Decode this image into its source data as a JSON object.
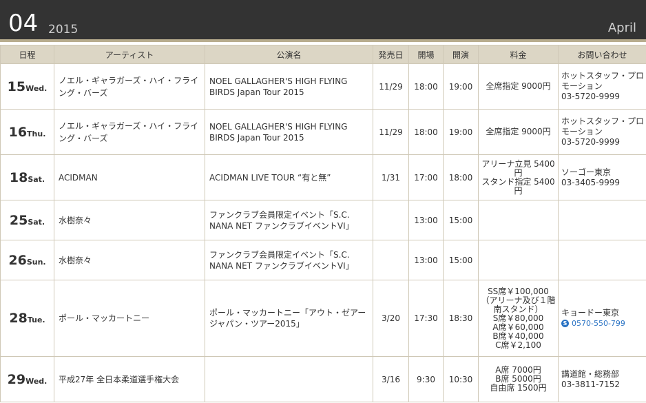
{
  "header": {
    "month": "04",
    "year": "2015",
    "month_name": "April"
  },
  "columns": [
    "日程",
    "アーティスト",
    "公演名",
    "発売日",
    "開場",
    "開演",
    "料金",
    "お問い合わせ"
  ],
  "rows": [
    {
      "day": "15",
      "weekday": "Wed.",
      "artist": "ノエル・ギャラガーズ・ハイ・フライング・バーズ",
      "title": "NOEL GALLAGHER'S HIGH FLYING BIRDS Japan Tour 2015",
      "sale": "11/29",
      "open": "18:00",
      "start": "19:00",
      "price": [
        "全席指定 9000円"
      ],
      "contact": [
        "ホットスタッフ・プロモーション",
        "03-5720-9999"
      ]
    },
    {
      "day": "16",
      "weekday": "Thu.",
      "artist": "ノエル・ギャラガーズ・ハイ・フライング・バーズ",
      "title": "NOEL GALLAGHER'S HIGH FLYING BIRDS Japan Tour 2015",
      "sale": "11/29",
      "open": "18:00",
      "start": "19:00",
      "price": [
        "全席指定 9000円"
      ],
      "contact": [
        "ホットスタッフ・プロモーション",
        "03-5720-9999"
      ]
    },
    {
      "day": "18",
      "weekday": "Sat.",
      "artist": "ACIDMAN",
      "title": "ACIDMAN LIVE TOUR “有と無”",
      "sale": "1/31",
      "open": "17:00",
      "start": "18:00",
      "price": [
        "アリーナ立見 5400円",
        "スタンド指定 5400円"
      ],
      "contact": [
        "ソーゴー東京",
        "03-3405-9999"
      ]
    },
    {
      "day": "25",
      "weekday": "Sat.",
      "artist": "水樹奈々",
      "title": "ファンクラブ会員限定イベント「S.C. NANA NET ファンクラブイベントVI」",
      "sale": "",
      "open": "13:00",
      "start": "15:00",
      "price": [],
      "contact": []
    },
    {
      "day": "26",
      "weekday": "Sun.",
      "artist": "水樹奈々",
      "title": "ファンクラブ会員限定イベント「S.C. NANA NET ファンクラブイベントVI」",
      "sale": "",
      "open": "13:00",
      "start": "15:00",
      "price": [],
      "contact": []
    },
    {
      "day": "28",
      "weekday": "Tue.",
      "artist": "ポール・マッカートニー",
      "title": "ポール・マッカートニー「アウト・ゼアー ジャパン・ツアー2015」",
      "sale": "3/20",
      "open": "17:30",
      "start": "18:30",
      "price": [
        "SS席￥100,000",
        "（アリーナ及び１階南スタンド）",
        "S席￥80,000",
        "A席￥60,000",
        "B席￥40,000",
        "C席￥2,100"
      ],
      "contact": [
        "キョードー東京"
      ],
      "contact_link": "0570-550-799",
      "contact_icon": "skype-icon"
    },
    {
      "day": "29",
      "weekday": "Wed.",
      "artist": "平成27年 全日本柔道選手権大会",
      "title": "",
      "sale": "3/16",
      "open": "9:30",
      "start": "10:30",
      "price": [
        "A席 7000円",
        "B席 5000円",
        "自由席 1500円"
      ],
      "contact": [
        "講道館・総務部",
        "03-3811-7152"
      ]
    }
  ],
  "colors": {
    "header_bg": "#333333",
    "table_header_bg": "#dcd6c5",
    "saturday": "#2a73c4",
    "sunday": "#d40000",
    "border": "#cfc8b6"
  }
}
